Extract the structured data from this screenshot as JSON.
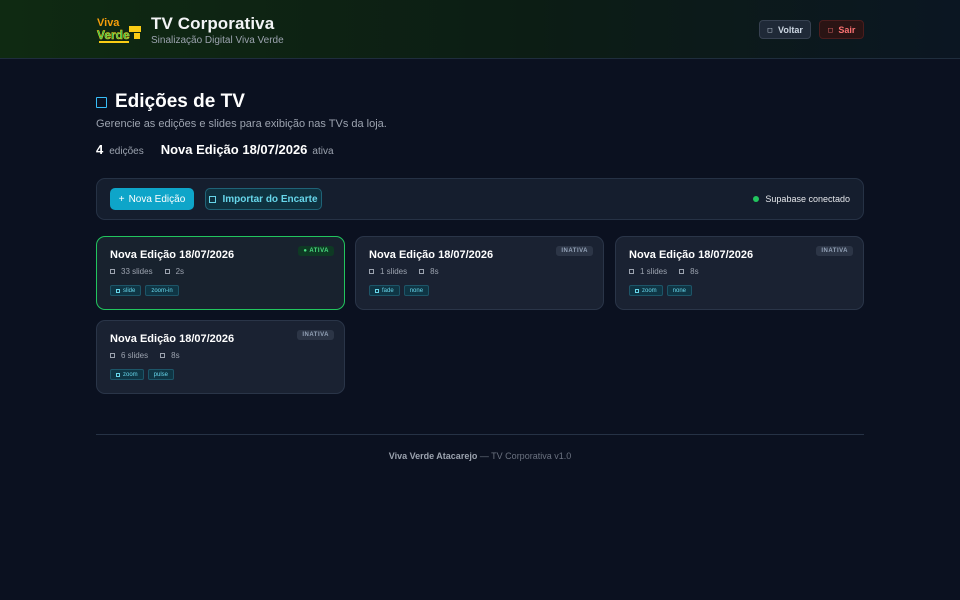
{
  "header": {
    "logo_text": "Viva Verde",
    "title": "TV Corporativa",
    "subtitle": "Sinalização Digital Viva Verde",
    "back_label": "Voltar",
    "logout_label": "Sair"
  },
  "page": {
    "title": "Edições de TV",
    "description": "Gerencie as edições e slides para exibição nas TVs da loja.",
    "edition_count": "4",
    "edition_count_label": "edições",
    "active_edition": "Nova Edição 18/07/2026",
    "active_label": "ativa"
  },
  "toolbar": {
    "new_label": "Nova Edição",
    "new_icon": "+",
    "import_label": "Importar do Encarte",
    "status_label": "Supabase conectado"
  },
  "editions": [
    {
      "title": "Nova Edição 18/07/2026",
      "badge": "● ATIVA",
      "slides": "33 slides",
      "duration": "2s",
      "tags": [
        "slide",
        "zoom-in"
      ]
    },
    {
      "title": "Nova Edição 18/07/2026",
      "badge": "INATIVA",
      "slides": "1 slides",
      "duration": "8s",
      "tags": [
        "fade",
        "none"
      ]
    },
    {
      "title": "Nova Edição 18/07/2026",
      "badge": "INATIVA",
      "slides": "1 slides",
      "duration": "8s",
      "tags": [
        "zoom",
        "none"
      ]
    },
    {
      "title": "Nova Edição 18/07/2026",
      "badge": "INATIVA",
      "slides": "6 slides",
      "duration": "8s",
      "tags": [
        "zoom",
        "pulse"
      ]
    }
  ],
  "footer": {
    "company": "Viva Verde Atacarejo",
    "suffix": "— TV Corporativa v1.0"
  },
  "colors": {
    "background": "#0b1120",
    "accent": "#0ea5c9",
    "active": "#22c55e",
    "danger": "#f87171"
  }
}
